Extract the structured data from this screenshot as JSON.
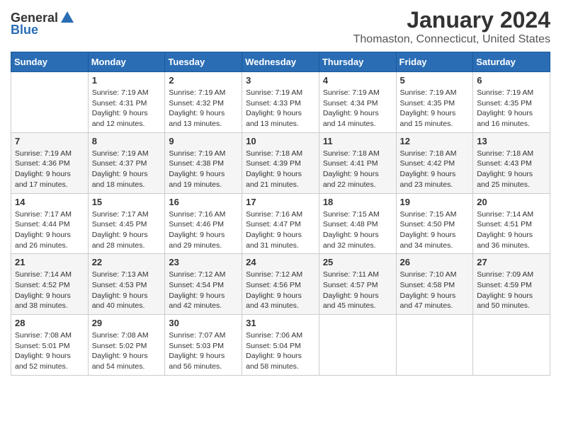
{
  "logo": {
    "general": "General",
    "blue": "Blue"
  },
  "title": "January 2024",
  "subtitle": "Thomaston, Connecticut, United States",
  "headers": [
    "Sunday",
    "Monday",
    "Tuesday",
    "Wednesday",
    "Thursday",
    "Friday",
    "Saturday"
  ],
  "weeks": [
    [
      {
        "num": "",
        "sunrise": "",
        "sunset": "",
        "daylight": ""
      },
      {
        "num": "1",
        "sunrise": "Sunrise: 7:19 AM",
        "sunset": "Sunset: 4:31 PM",
        "daylight": "Daylight: 9 hours and 12 minutes."
      },
      {
        "num": "2",
        "sunrise": "Sunrise: 7:19 AM",
        "sunset": "Sunset: 4:32 PM",
        "daylight": "Daylight: 9 hours and 13 minutes."
      },
      {
        "num": "3",
        "sunrise": "Sunrise: 7:19 AM",
        "sunset": "Sunset: 4:33 PM",
        "daylight": "Daylight: 9 hours and 13 minutes."
      },
      {
        "num": "4",
        "sunrise": "Sunrise: 7:19 AM",
        "sunset": "Sunset: 4:34 PM",
        "daylight": "Daylight: 9 hours and 14 minutes."
      },
      {
        "num": "5",
        "sunrise": "Sunrise: 7:19 AM",
        "sunset": "Sunset: 4:35 PM",
        "daylight": "Daylight: 9 hours and 15 minutes."
      },
      {
        "num": "6",
        "sunrise": "Sunrise: 7:19 AM",
        "sunset": "Sunset: 4:35 PM",
        "daylight": "Daylight: 9 hours and 16 minutes."
      }
    ],
    [
      {
        "num": "7",
        "sunrise": "Sunrise: 7:19 AM",
        "sunset": "Sunset: 4:36 PM",
        "daylight": "Daylight: 9 hours and 17 minutes."
      },
      {
        "num": "8",
        "sunrise": "Sunrise: 7:19 AM",
        "sunset": "Sunset: 4:37 PM",
        "daylight": "Daylight: 9 hours and 18 minutes."
      },
      {
        "num": "9",
        "sunrise": "Sunrise: 7:19 AM",
        "sunset": "Sunset: 4:38 PM",
        "daylight": "Daylight: 9 hours and 19 minutes."
      },
      {
        "num": "10",
        "sunrise": "Sunrise: 7:18 AM",
        "sunset": "Sunset: 4:39 PM",
        "daylight": "Daylight: 9 hours and 21 minutes."
      },
      {
        "num": "11",
        "sunrise": "Sunrise: 7:18 AM",
        "sunset": "Sunset: 4:41 PM",
        "daylight": "Daylight: 9 hours and 22 minutes."
      },
      {
        "num": "12",
        "sunrise": "Sunrise: 7:18 AM",
        "sunset": "Sunset: 4:42 PM",
        "daylight": "Daylight: 9 hours and 23 minutes."
      },
      {
        "num": "13",
        "sunrise": "Sunrise: 7:18 AM",
        "sunset": "Sunset: 4:43 PM",
        "daylight": "Daylight: 9 hours and 25 minutes."
      }
    ],
    [
      {
        "num": "14",
        "sunrise": "Sunrise: 7:17 AM",
        "sunset": "Sunset: 4:44 PM",
        "daylight": "Daylight: 9 hours and 26 minutes."
      },
      {
        "num": "15",
        "sunrise": "Sunrise: 7:17 AM",
        "sunset": "Sunset: 4:45 PM",
        "daylight": "Daylight: 9 hours and 28 minutes."
      },
      {
        "num": "16",
        "sunrise": "Sunrise: 7:16 AM",
        "sunset": "Sunset: 4:46 PM",
        "daylight": "Daylight: 9 hours and 29 minutes."
      },
      {
        "num": "17",
        "sunrise": "Sunrise: 7:16 AM",
        "sunset": "Sunset: 4:47 PM",
        "daylight": "Daylight: 9 hours and 31 minutes."
      },
      {
        "num": "18",
        "sunrise": "Sunrise: 7:15 AM",
        "sunset": "Sunset: 4:48 PM",
        "daylight": "Daylight: 9 hours and 32 minutes."
      },
      {
        "num": "19",
        "sunrise": "Sunrise: 7:15 AM",
        "sunset": "Sunset: 4:50 PM",
        "daylight": "Daylight: 9 hours and 34 minutes."
      },
      {
        "num": "20",
        "sunrise": "Sunrise: 7:14 AM",
        "sunset": "Sunset: 4:51 PM",
        "daylight": "Daylight: 9 hours and 36 minutes."
      }
    ],
    [
      {
        "num": "21",
        "sunrise": "Sunrise: 7:14 AM",
        "sunset": "Sunset: 4:52 PM",
        "daylight": "Daylight: 9 hours and 38 minutes."
      },
      {
        "num": "22",
        "sunrise": "Sunrise: 7:13 AM",
        "sunset": "Sunset: 4:53 PM",
        "daylight": "Daylight: 9 hours and 40 minutes."
      },
      {
        "num": "23",
        "sunrise": "Sunrise: 7:12 AM",
        "sunset": "Sunset: 4:54 PM",
        "daylight": "Daylight: 9 hours and 42 minutes."
      },
      {
        "num": "24",
        "sunrise": "Sunrise: 7:12 AM",
        "sunset": "Sunset: 4:56 PM",
        "daylight": "Daylight: 9 hours and 43 minutes."
      },
      {
        "num": "25",
        "sunrise": "Sunrise: 7:11 AM",
        "sunset": "Sunset: 4:57 PM",
        "daylight": "Daylight: 9 hours and 45 minutes."
      },
      {
        "num": "26",
        "sunrise": "Sunrise: 7:10 AM",
        "sunset": "Sunset: 4:58 PM",
        "daylight": "Daylight: 9 hours and 47 minutes."
      },
      {
        "num": "27",
        "sunrise": "Sunrise: 7:09 AM",
        "sunset": "Sunset: 4:59 PM",
        "daylight": "Daylight: 9 hours and 50 minutes."
      }
    ],
    [
      {
        "num": "28",
        "sunrise": "Sunrise: 7:08 AM",
        "sunset": "Sunset: 5:01 PM",
        "daylight": "Daylight: 9 hours and 52 minutes."
      },
      {
        "num": "29",
        "sunrise": "Sunrise: 7:08 AM",
        "sunset": "Sunset: 5:02 PM",
        "daylight": "Daylight: 9 hours and 54 minutes."
      },
      {
        "num": "30",
        "sunrise": "Sunrise: 7:07 AM",
        "sunset": "Sunset: 5:03 PM",
        "daylight": "Daylight: 9 hours and 56 minutes."
      },
      {
        "num": "31",
        "sunrise": "Sunrise: 7:06 AM",
        "sunset": "Sunset: 5:04 PM",
        "daylight": "Daylight: 9 hours and 58 minutes."
      },
      {
        "num": "",
        "sunrise": "",
        "sunset": "",
        "daylight": ""
      },
      {
        "num": "",
        "sunrise": "",
        "sunset": "",
        "daylight": ""
      },
      {
        "num": "",
        "sunrise": "",
        "sunset": "",
        "daylight": ""
      }
    ]
  ]
}
